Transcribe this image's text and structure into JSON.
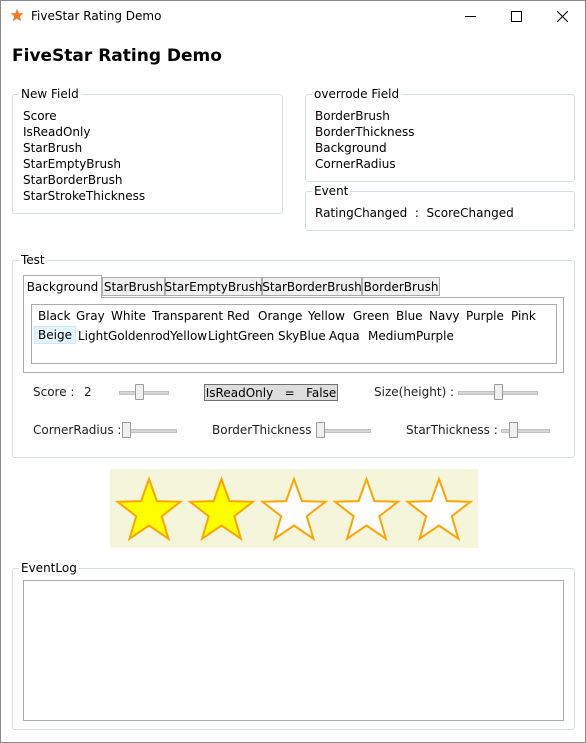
{
  "window": {
    "title": "FiveStar Rating Demo",
    "minimize_icon": "minimize-icon",
    "maximize_icon": "maximize-icon",
    "close_icon": "close-icon",
    "app_icon": "star-icon"
  },
  "heading": "FiveStar Rating Demo",
  "new_field": {
    "legend": "New Field",
    "items": [
      "Score",
      "IsReadOnly",
      "StarBrush",
      "StarEmptyBrush",
      "StarBorderBrush",
      "StarStrokeThickness"
    ]
  },
  "overrode_field": {
    "legend": "overrode Field",
    "items": [
      "BorderBrush",
      "BorderThickness",
      "Background",
      "CornerRadius"
    ]
  },
  "event_group": {
    "legend": "Event",
    "text": "RatingChanged  :  ScoreChanged"
  },
  "test": {
    "legend": "Test",
    "tabs": [
      "Background",
      "StarBrush",
      "StarEmptyBrush",
      "StarBorderBrush",
      "BorderBrush"
    ],
    "active_tab": "Background",
    "colors_row1": [
      "Black",
      "Gray",
      "White",
      "Transparent",
      "Red",
      "Orange",
      "Yellow",
      "Green",
      "Blue",
      "Navy",
      "Purple",
      "Pink"
    ],
    "colors_row2": [
      "Beige",
      "LightGoldenrodYellow",
      "LightGreen",
      "SkyBlue",
      "Aqua",
      "MediumPurple"
    ],
    "selected_color": "Beige",
    "score_label": "Score :",
    "score_value": "2",
    "score_slider_level": 0.4,
    "isreadonly_button": "IsReadOnly   =   False",
    "size_label": "Size(height) :",
    "size_slider_level": 0.5,
    "cornerradius_label": "CornerRadius :",
    "cornerradius_slider_level": 0.0,
    "borderthickness_label": "BorderThickness :",
    "borderthickness_slider_level": 0.0,
    "starthickness_label": "StarThickness :",
    "starthickness_slider_level": 0.2
  },
  "rating": {
    "score": 2,
    "max": 5,
    "background": "#f5f5dc",
    "star_fill": "#ffff00",
    "star_empty": "#ffffff",
    "star_border": "#ffa500"
  },
  "event_log": {
    "legend": "EventLog",
    "content": ""
  }
}
